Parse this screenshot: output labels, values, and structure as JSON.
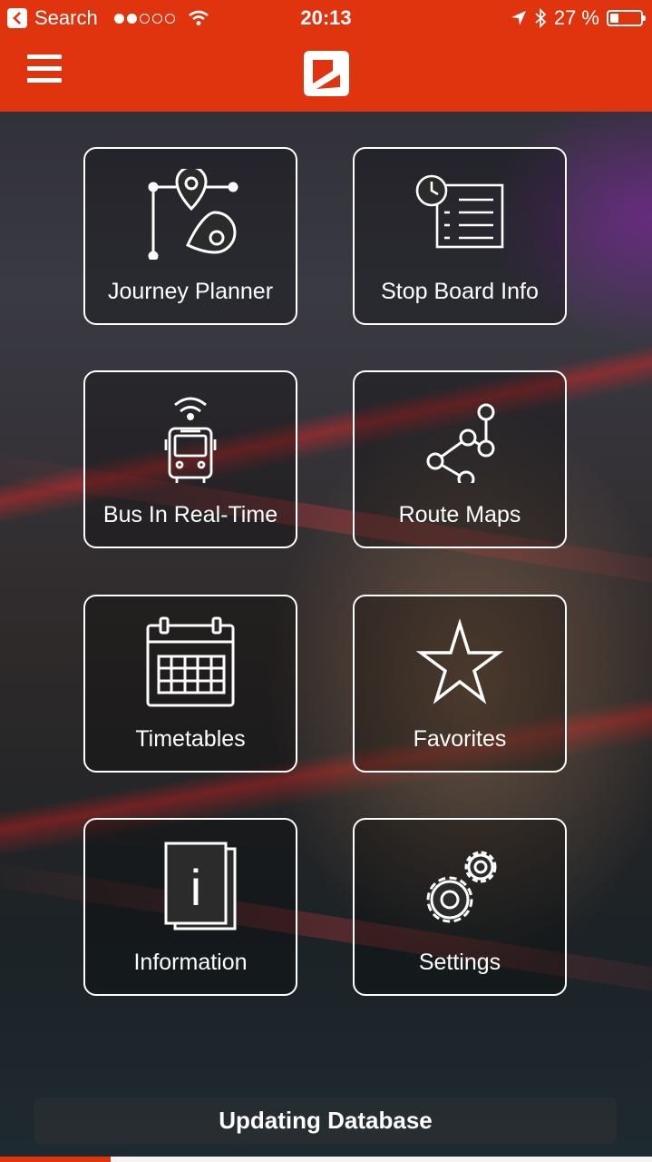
{
  "status_bar": {
    "back_label": "Search",
    "time": "20:13",
    "battery": "27 %",
    "signal_dots": [
      true,
      true,
      false,
      false,
      false
    ],
    "battery_level": 0.27
  },
  "navbar": {
    "menu_icon": "hamburger-icon",
    "logo_icon": "app-logo",
    "color": "#e0340f"
  },
  "tiles": [
    {
      "label": "Journey Planner",
      "icon": "route-pin-icon"
    },
    {
      "label": "Stop Board Info",
      "icon": "clock-list-icon"
    },
    {
      "label": "Bus In Real-Time",
      "icon": "bus-wifi-icon"
    },
    {
      "label": "Route Maps",
      "icon": "route-nodes-icon"
    },
    {
      "label": "Timetables",
      "icon": "calendar-icon"
    },
    {
      "label": "Favorites",
      "icon": "star-icon"
    },
    {
      "label": "Information",
      "icon": "info-document-icon"
    },
    {
      "label": "Settings",
      "icon": "gears-icon"
    }
  ],
  "footer": {
    "status_text": "Updating Database",
    "progress": 0.17
  }
}
